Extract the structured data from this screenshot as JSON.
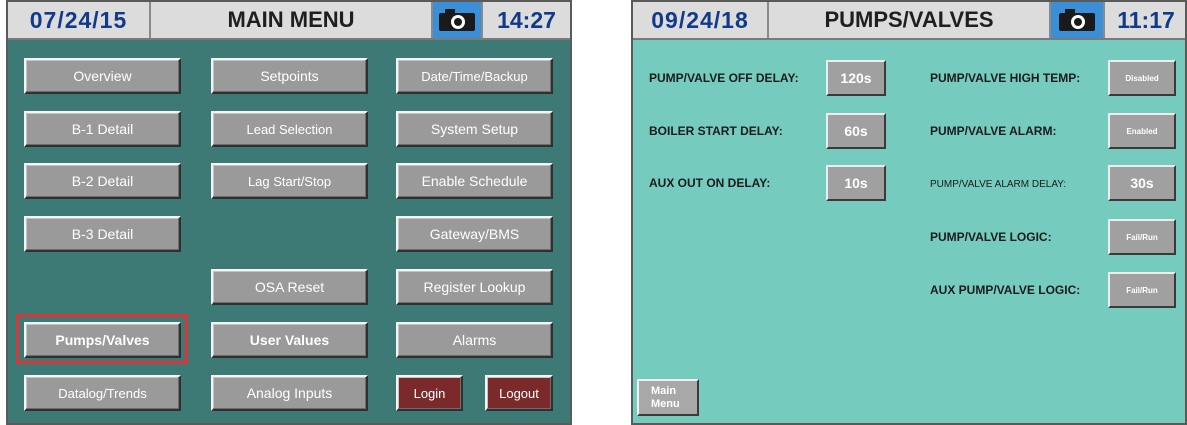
{
  "main_menu": {
    "header": {
      "date": "07/24/15",
      "title": "MAIN MENU",
      "time": "14:27",
      "camera_icon": "camera-icon"
    },
    "buttons": {
      "overview": "Overview",
      "setpoints": "Setpoints",
      "date_time_backup": "Date/Time/Backup",
      "b1_detail": "B-1 Detail",
      "lead_selection": "Lead Selection",
      "system_setup": "System Setup",
      "b2_detail": "B-2 Detail",
      "lag_start_stop": "Lag Start/Stop",
      "enable_schedule": "Enable Schedule",
      "b3_detail": "B-3 Detail",
      "gateway_bms": "Gateway/BMS",
      "osa_reset": "OSA Reset",
      "register_lookup": "Register Lookup",
      "pumps_valves": "Pumps/Valves",
      "user_values": "User Values",
      "alarms": "Alarms",
      "datalog_trends": "Datalog/Trends",
      "analog_inputs": "Analog Inputs",
      "login": "Login",
      "logout": "Logout"
    },
    "colors": {
      "background": "#3d7a76",
      "selection_outline": "#d8383a"
    }
  },
  "pumps_valves": {
    "header": {
      "date": "09/24/18",
      "title": "PUMPS/VALVES",
      "time": "11:17",
      "camera_icon": "camera-icon"
    },
    "settings": {
      "off_delay": {
        "label": "PUMP/VALVE OFF DELAY:",
        "value": "120s"
      },
      "boiler_start_delay": {
        "label": "BOILER START DELAY:",
        "value": "60s"
      },
      "aux_out_on_delay": {
        "label": "AUX OUT ON DELAY:",
        "value": "10s"
      },
      "high_temp": {
        "label": "PUMP/VALVE HIGH TEMP:",
        "value": "Disabled"
      },
      "alarm": {
        "label": "PUMP/VALVE ALARM:",
        "value": "Enabled"
      },
      "alarm_delay": {
        "label": "PUMP/VALVE ALARM DELAY:",
        "value": "30s"
      },
      "logic": {
        "label": "PUMP/VALVE LOGIC:",
        "value": "Fail/Run"
      },
      "aux_logic": {
        "label": "AUX PUMP/VALVE LOGIC:",
        "value": "Fail/Run"
      }
    },
    "main_menu_button": {
      "line1": "Main",
      "line2": "Menu"
    },
    "colors": {
      "background": "#76cbbf"
    }
  }
}
